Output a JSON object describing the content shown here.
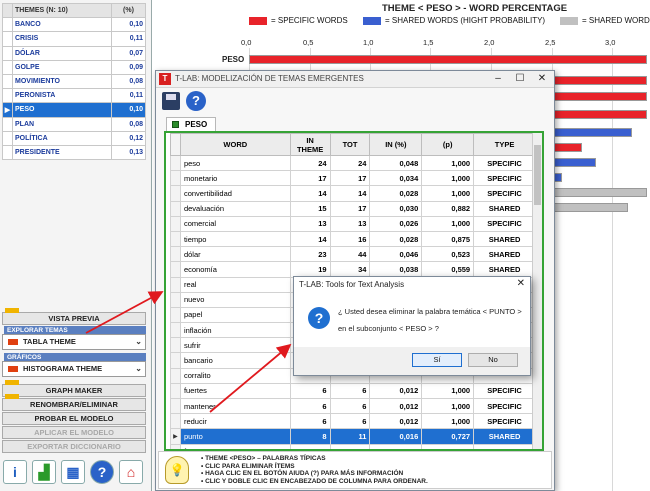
{
  "themes": {
    "header": {
      "name": "THEMES (N: 10)",
      "pct": "(%)"
    },
    "rows": [
      {
        "name": "BANCO",
        "value": "0,10"
      },
      {
        "name": "CRISIS",
        "value": "0,11"
      },
      {
        "name": "DÓLAR",
        "value": "0,07"
      },
      {
        "name": "GOLPE",
        "value": "0,09"
      },
      {
        "name": "MOVIMIENTO",
        "value": "0,08"
      },
      {
        "name": "PERONISTA",
        "value": "0,11"
      },
      {
        "name": "PESO",
        "value": "0,10",
        "selected": true
      },
      {
        "name": "PLAN",
        "value": "0,08"
      },
      {
        "name": "POLÍTICA",
        "value": "0,12"
      },
      {
        "name": "PRESIDENTE",
        "value": "0,13"
      }
    ]
  },
  "left_panel": {
    "vista_previa": "VISTA PREVIA",
    "explorar_label": "EXPLORAR TEMAS",
    "explorar_value": "TABLA THEME",
    "graficos_label": "GRÁFICOS",
    "graficos_value": "HISTOGRAMA THEME",
    "graph_maker": "GRAPH MAKER",
    "renombrar": "RENOMBRAR/ELIMINAR",
    "probar": "PROBAR EL MODELO",
    "aplicar": "APLICAR EL MODELO",
    "exportar": "EXPORTAR DICCIONARIO"
  },
  "chart": {
    "title": "THEME < PESO > - WORD PERCENTAGE",
    "legend": [
      {
        "label": "= SPECIFIC WORDS",
        "color": "#e8232a"
      },
      {
        "label": "= SHARED WORDS (HIGHT PROBABILITY)",
        "color": "#3a5fd0"
      },
      {
        "label": "= SHARED WORDS",
        "color": "#c0c0c0"
      }
    ],
    "ticks": [
      "0,0",
      "0,5",
      "1,0",
      "1,5",
      "2,0",
      "2,5",
      "3,0"
    ],
    "first_label": "PESO"
  },
  "window": {
    "title": "T-LAB: MODELIZACIÓN DE TEMAS EMERGENTES",
    "logo": "T",
    "tab": "PESO",
    "columns": [
      "WORD",
      "IN THEME",
      "TOT",
      "IN (%)",
      "(p)",
      "TYPE"
    ],
    "rows": [
      {
        "word": "peso",
        "in_theme": "24",
        "tot": "24",
        "in_pct": "0,048",
        "p": "1,000",
        "type": "SPECIFIC"
      },
      {
        "word": "monetario",
        "in_theme": "17",
        "tot": "17",
        "in_pct": "0,034",
        "p": "1,000",
        "type": "SPECIFIC"
      },
      {
        "word": "convertibilidad",
        "in_theme": "14",
        "tot": "14",
        "in_pct": "0,028",
        "p": "1,000",
        "type": "SPECIFIC"
      },
      {
        "word": "devaluación",
        "in_theme": "15",
        "tot": "17",
        "in_pct": "0,030",
        "p": "0,882",
        "type": "SHARED"
      },
      {
        "word": "comercial",
        "in_theme": "13",
        "tot": "13",
        "in_pct": "0,026",
        "p": "1,000",
        "type": "SPECIFIC"
      },
      {
        "word": "tiempo",
        "in_theme": "14",
        "tot": "16",
        "in_pct": "0,028",
        "p": "0,875",
        "type": "SHARED"
      },
      {
        "word": "dólar",
        "in_theme": "23",
        "tot": "44",
        "in_pct": "0,046",
        "p": "0,523",
        "type": "SHARED"
      },
      {
        "word": "economía",
        "in_theme": "19",
        "tot": "34",
        "in_pct": "0,038",
        "p": "0,559",
        "type": "SHARED"
      },
      {
        "word": "real",
        "in_theme": "",
        "tot": "",
        "in_pct": "",
        "p": "",
        "type": ""
      },
      {
        "word": "nuevo",
        "in_theme": "",
        "tot": "",
        "in_pct": "",
        "p": "",
        "type": ""
      },
      {
        "word": "papel",
        "in_theme": "",
        "tot": "",
        "in_pct": "",
        "p": "",
        "type": ""
      },
      {
        "word": "inflación",
        "in_theme": "",
        "tot": "",
        "in_pct": "",
        "p": "",
        "type": ""
      },
      {
        "word": "sufrir",
        "in_theme": "",
        "tot": "",
        "in_pct": "",
        "p": "",
        "type": ""
      },
      {
        "word": "bancario",
        "in_theme": "",
        "tot": "",
        "in_pct": "",
        "p": "",
        "type": ""
      },
      {
        "word": "corralito",
        "in_theme": "",
        "tot": "",
        "in_pct": "",
        "p": "",
        "type": ""
      },
      {
        "word": "fuertes",
        "in_theme": "6",
        "tot": "6",
        "in_pct": "0,012",
        "p": "1,000",
        "type": "SPECIFIC"
      },
      {
        "word": "mantener",
        "in_theme": "6",
        "tot": "6",
        "in_pct": "0,012",
        "p": "1,000",
        "type": "SPECIFIC"
      },
      {
        "word": "reducir",
        "in_theme": "6",
        "tot": "6",
        "in_pct": "0,012",
        "p": "1,000",
        "type": "SPECIFIC"
      },
      {
        "word": "punto",
        "in_theme": "8",
        "tot": "11",
        "in_pct": "0,016",
        "p": "0,727",
        "type": "SHARED",
        "selected": true
      },
      {
        "word": "forma",
        "in_theme": "8",
        "tot": "11",
        "in_pct": "0,016",
        "p": "0,727",
        "type": "SHARED"
      }
    ],
    "info_lines": [
      "• THEME <PESO> – PALABRAS TÍPICAS",
      "• CLIC PARA ELIMINAR ÍTEMS",
      "• HAGA CLIC EN EL BOTÓN AIUDA (?) PARA MÁS INFORMACIÓN",
      "• CLIC Y DOBLE CLIC EN ENCABEZADO DE COLUMNA PARA ORDENAR."
    ]
  },
  "dialog": {
    "title": "T-LAB: Tools for Text Analysis",
    "line1": "¿ Usted desea eliminar la palabra temática < PUNTO >",
    "line2": "en el subconjunto  < PESO > ?",
    "yes": "Sí",
    "no": "No"
  }
}
